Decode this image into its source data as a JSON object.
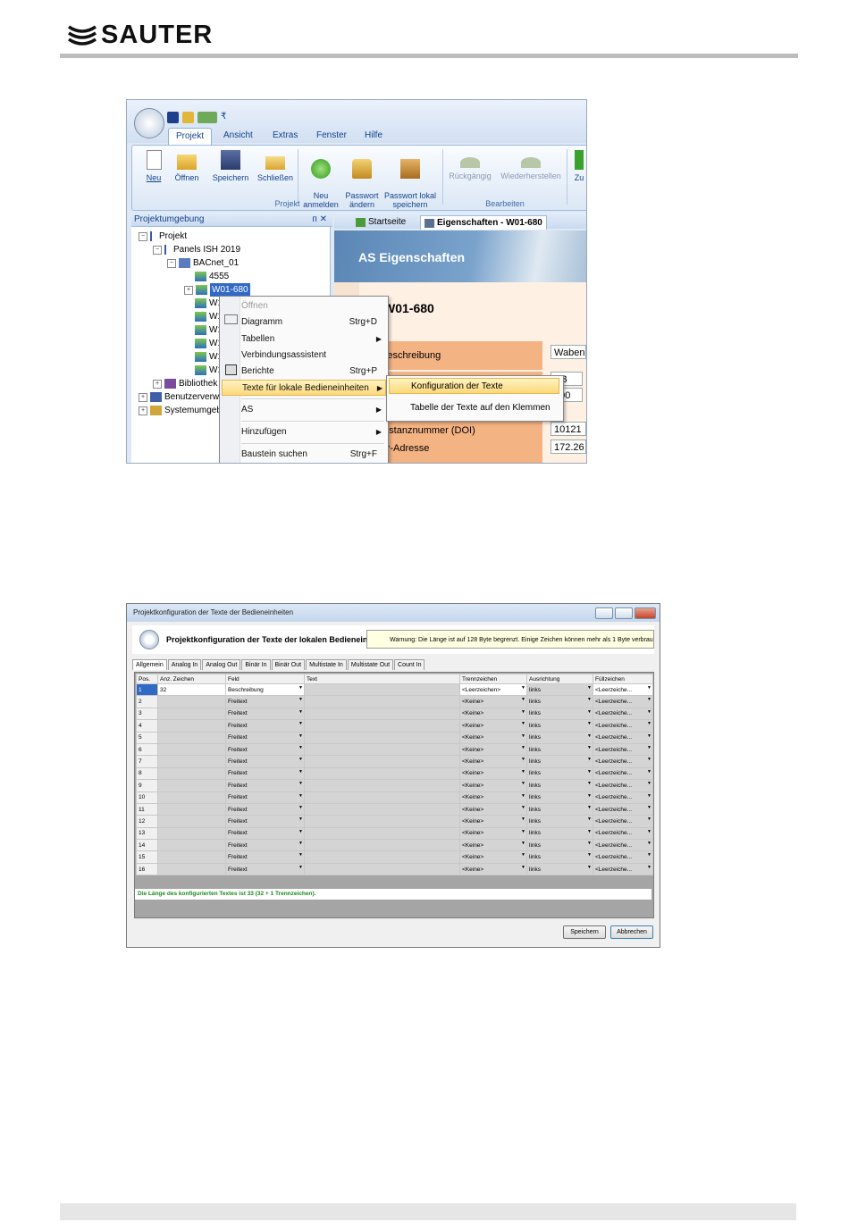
{
  "header": {
    "logo_text": "SAUTER"
  },
  "shot1": {
    "qat_more": "₹",
    "tabs": [
      "Projekt",
      "Ansicht",
      "Extras",
      "Fenster",
      "Hilfe"
    ],
    "ribbon_buttons": [
      {
        "label": "Neu"
      },
      {
        "label": "Öffnen"
      },
      {
        "label": "Speichern"
      },
      {
        "label": "Schließen"
      },
      {
        "label": "Neu\nanmelden"
      },
      {
        "label": "Passwort\nändern"
      },
      {
        "label": "Passwort lokal\nspeichern"
      },
      {
        "label": "Rückgängig"
      },
      {
        "label": "Wiederherstellen"
      },
      {
        "label": "Zu"
      }
    ],
    "ribbon_groups": [
      "Projekt",
      "Bearbeiten"
    ],
    "panel_title": "Projektumgebung",
    "panel_pin": "ᴨ  ✕",
    "tree": {
      "project": "Projekt",
      "panels": "Panels ISH 2019",
      "bacnet": "BACnet_01",
      "n4555": "4555",
      "w01": "W01-680",
      "others": [
        "W1",
        "W1",
        "W1",
        "W1",
        "W1",
        "W1"
      ],
      "bibliothek": "Bibliothek",
      "benutzer": "Benutzerverw",
      "system": "Systemumgeb"
    },
    "doc_tabs": [
      "Startseite",
      "Eigenschaften - W01-680"
    ],
    "doc_banner": "AS Eigenschaften",
    "doc_title": "W01-680",
    "props": [
      {
        "label": "Beschreibung",
        "value": "Waben"
      },
      {
        "label": "",
        "value": "AB"
      },
      {
        "label": "",
        "value": "000"
      },
      {
        "label": "Instanznummer (DOI)",
        "value": "10121"
      },
      {
        "label": "IP-Adresse",
        "value": "172.26"
      }
    ],
    "context_menu": [
      {
        "label": "Öffnen",
        "shortcut": ""
      },
      {
        "label": "Diagramm",
        "shortcut": "Strg+D"
      },
      {
        "label": "Tabellen",
        "shortcut": ""
      },
      {
        "label": "Verbindungsassistent",
        "shortcut": ""
      },
      {
        "label": "Berichte",
        "shortcut": "Strg+P"
      },
      {
        "label": "Texte für lokale Bedieneinheiten",
        "shortcut": ""
      },
      {
        "label": "AS",
        "shortcut": ""
      },
      {
        "label": "Hinzufügen",
        "shortcut": ""
      },
      {
        "label": "Baustein suchen",
        "shortcut": "Strg+F"
      }
    ],
    "submenu": [
      "Konfiguration der Texte",
      "Tabelle der Texte auf den Klemmen"
    ]
  },
  "shot2": {
    "window_title": "Projektkonfiguration der Texte der Bedieneinheiten",
    "dialog_title": "Projektkonfiguration der Texte der lokalen Bedieneinheiten",
    "warning": "Warnung: Die Länge ist auf 128 Byte begrenzt. Einige Zeichen können mehr als 1 Byte verbrau",
    "tabs": [
      "Allgemein",
      "Analog In",
      "Analog Out",
      "Binär In",
      "Binär Out",
      "Multistate In",
      "Multistate Out",
      "Count In"
    ],
    "columns": [
      "Pos.",
      "Anz. Zeichen",
      "Feld",
      "Text",
      "Trennzeichen",
      "Ausrichtung",
      "Füllzeichen"
    ],
    "rows": [
      {
        "pos": "1",
        "count": "32",
        "field": "Beschreibung",
        "sep": "<Leerzeichen>",
        "align": "links",
        "fill": "<Leerzeiche..."
      },
      {
        "pos": "2",
        "count": "",
        "field": "Freitext",
        "sep": "<Keine>",
        "align": "links",
        "fill": "<Leerzeiche..."
      },
      {
        "pos": "3",
        "count": "",
        "field": "Freitext",
        "sep": "<Keine>",
        "align": "links",
        "fill": "<Leerzeiche..."
      },
      {
        "pos": "4",
        "count": "",
        "field": "Freitext",
        "sep": "<Keine>",
        "align": "links",
        "fill": "<Leerzeiche..."
      },
      {
        "pos": "5",
        "count": "",
        "field": "Freitext",
        "sep": "<Keine>",
        "align": "links",
        "fill": "<Leerzeiche..."
      },
      {
        "pos": "6",
        "count": "",
        "field": "Freitext",
        "sep": "<Keine>",
        "align": "links",
        "fill": "<Leerzeiche..."
      },
      {
        "pos": "7",
        "count": "",
        "field": "Freitext",
        "sep": "<Keine>",
        "align": "links",
        "fill": "<Leerzeiche..."
      },
      {
        "pos": "8",
        "count": "",
        "field": "Freitext",
        "sep": "<Keine>",
        "align": "links",
        "fill": "<Leerzeiche..."
      },
      {
        "pos": "9",
        "count": "",
        "field": "Freitext",
        "sep": "<Keine>",
        "align": "links",
        "fill": "<Leerzeiche..."
      },
      {
        "pos": "10",
        "count": "",
        "field": "Freitext",
        "sep": "<Keine>",
        "align": "links",
        "fill": "<Leerzeiche..."
      },
      {
        "pos": "11",
        "count": "",
        "field": "Freitext",
        "sep": "<Keine>",
        "align": "links",
        "fill": "<Leerzeiche..."
      },
      {
        "pos": "12",
        "count": "",
        "field": "Freitext",
        "sep": "<Keine>",
        "align": "links",
        "fill": "<Leerzeiche..."
      },
      {
        "pos": "13",
        "count": "",
        "field": "Freitext",
        "sep": "<Keine>",
        "align": "links",
        "fill": "<Leerzeiche..."
      },
      {
        "pos": "14",
        "count": "",
        "field": "Freitext",
        "sep": "<Keine>",
        "align": "links",
        "fill": "<Leerzeiche..."
      },
      {
        "pos": "15",
        "count": "",
        "field": "Freitext",
        "sep": "<Keine>",
        "align": "links",
        "fill": "<Leerzeiche..."
      },
      {
        "pos": "16",
        "count": "",
        "field": "Freitext",
        "sep": "<Keine>",
        "align": "links",
        "fill": "<Leerzeiche..."
      }
    ],
    "status": "Die Länge des konfigurierten Textes ist 33 (32 + 1 Trennzeichen).",
    "save_label": "Speichern",
    "cancel_label": "Abbrechen"
  },
  "colors": {
    "accent": "#3169c6",
    "menu_highlight": "#fcd87a",
    "ok_green": "#1a8c1a",
    "prop_orange": "#f4b383"
  }
}
